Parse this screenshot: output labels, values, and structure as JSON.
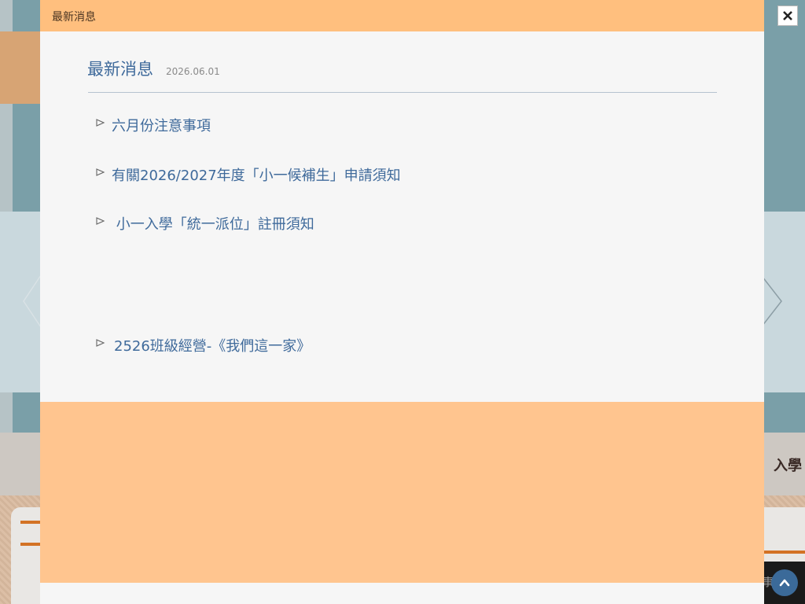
{
  "modal": {
    "header_title": "最新消息",
    "close_icon": "close-icon"
  },
  "news": {
    "title": "最新消息",
    "date": "2026.06.01",
    "items": [
      {
        "label": "六月份注意事項"
      },
      {
        "label": "有關2026/2027年度「小一候補生」申請須知"
      },
      {
        "label": " 小一入學「統一派位」註冊須知"
      },
      {
        "label": "2526班級經營-《我們這一家》"
      }
    ]
  },
  "background": {
    "enroll_text": "入學",
    "footer_text": "事"
  },
  "colors": {
    "header_bg": "#ffbf7e",
    "link": "#3f6a9b",
    "modal_bg": "#f6f6f6",
    "orange_block": "#ffc58f",
    "scroll_button": "#3b6a99"
  }
}
